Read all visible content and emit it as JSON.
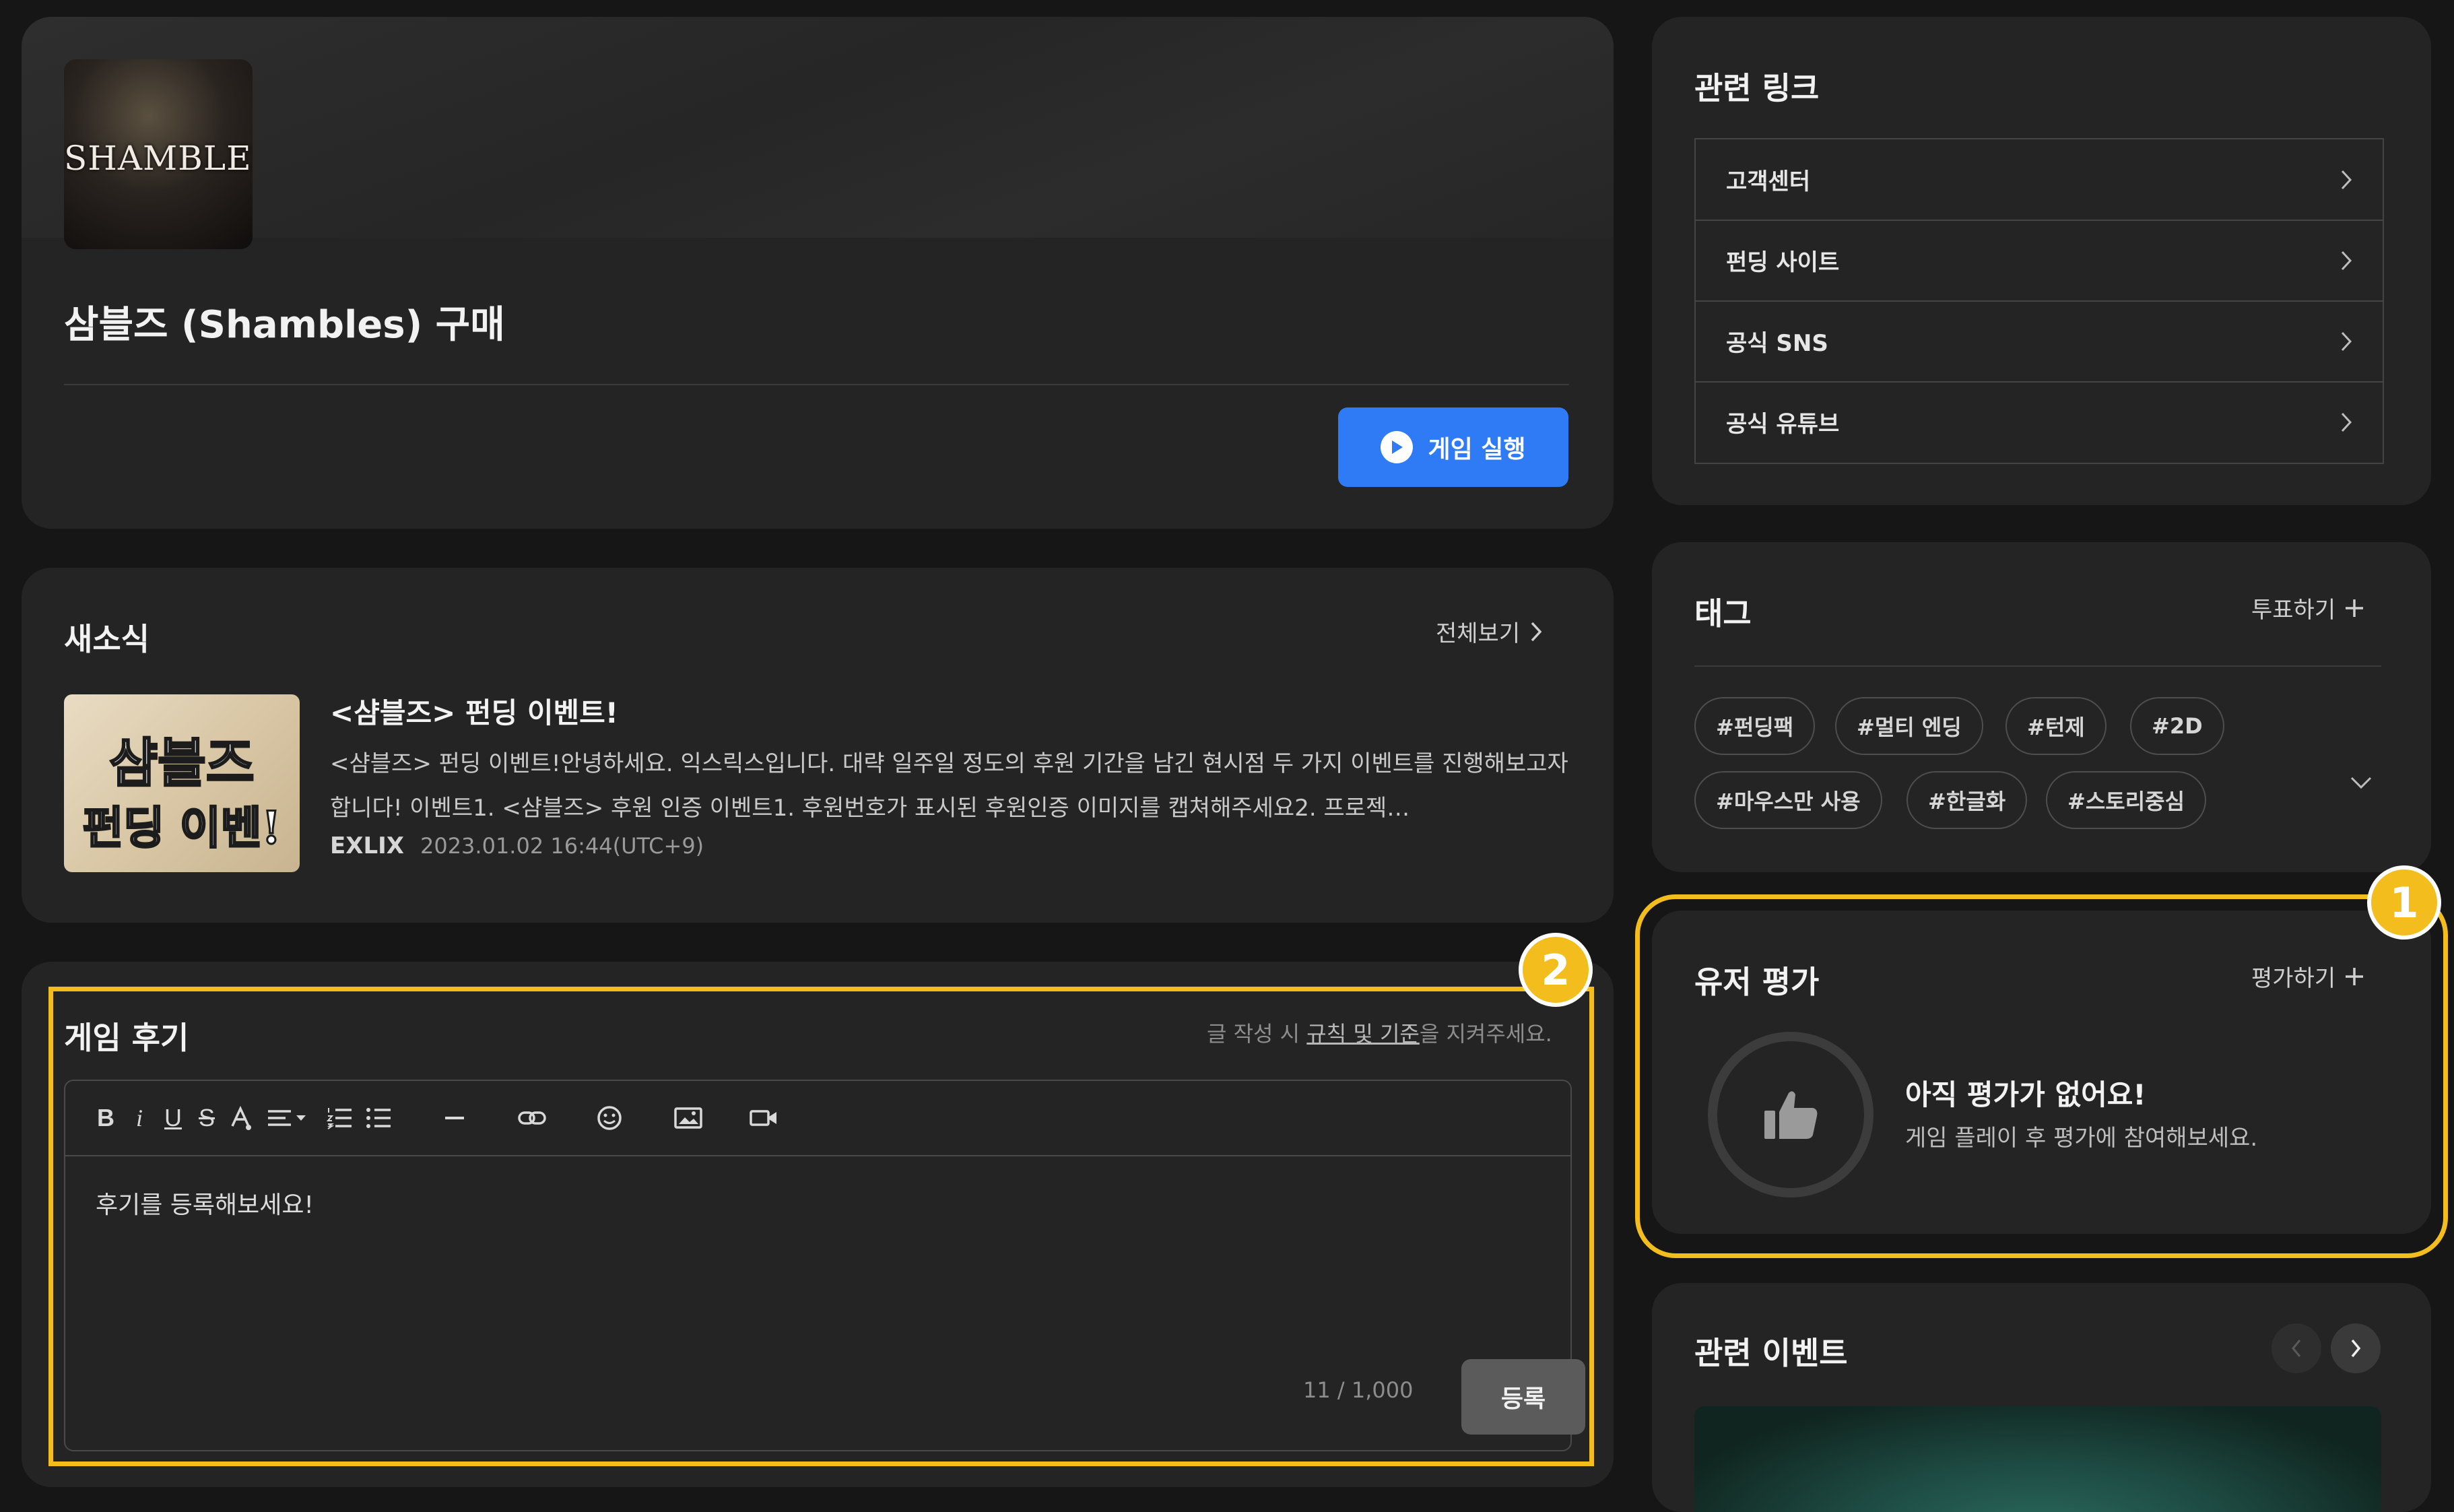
{
  "game": {
    "cover_text": "SHAMBLES",
    "title": "삼블즈 (Shambles) 구매",
    "launch_label": "게임 실행"
  },
  "news": {
    "title": "새소식",
    "view_all": "전체보기",
    "thumb_line1": "샴블즈",
    "thumb_line2": "펀딩 이벤!",
    "item": {
      "title": "<샴블즈> 펀딩 이벤트!",
      "body": "<샴블즈> 펀딩 이벤트!안녕하세요. 익스릭스입니다. 대략 일주일 정도의 후원 기간을 남긴 현시점 두 가지 이벤트를 진행해보고자 합니다! 이벤트1. <샴블즈> 후원 인증 이벤트1. 후원번호가 표시된 후원인증 이미지를 캡쳐해주세요2. 프로젝…",
      "author": "EXLIX",
      "date": "2023.01.02 16:44(UTC+9)"
    }
  },
  "review": {
    "title": "게임 후기",
    "guide_prefix": "글 작성 시 ",
    "guide_link": "규칙 및 기준",
    "guide_suffix": "을 지켜주세요.",
    "content": "후기를 등록해보세요!",
    "count": "11 / 1,000",
    "submit": "등록",
    "toolbar": [
      "bold",
      "italic",
      "underline",
      "strikethrough",
      "text-color",
      "align",
      "ordered-list",
      "bullet-list",
      "horizontal-rule",
      "link",
      "emoji",
      "image",
      "video"
    ]
  },
  "links": {
    "title": "관련 링크",
    "items": [
      "고객센터",
      "펀딩 사이트",
      "공식 SNS",
      "공식 유튜브"
    ]
  },
  "tags": {
    "title": "태그",
    "vote": "투표하기",
    "items": [
      "#펀딩팩",
      "#멀티 엔딩",
      "#턴제",
      "#2D",
      "#마우스만 사용",
      "#한글화",
      "#스토리중심"
    ]
  },
  "rating": {
    "title": "유저 평가",
    "add": "평가하기",
    "empty_title": "아직 평가가 없어요!",
    "empty_hint": "게임 플레이 후 평가에 참여해보세요."
  },
  "events": {
    "title": "관련 이벤트"
  },
  "annotations": {
    "badge1": "1",
    "badge2": "2"
  },
  "colors": {
    "accent": "#2f7bf5",
    "highlight": "#f2bd1d",
    "card": "#242424",
    "background": "#161616"
  }
}
